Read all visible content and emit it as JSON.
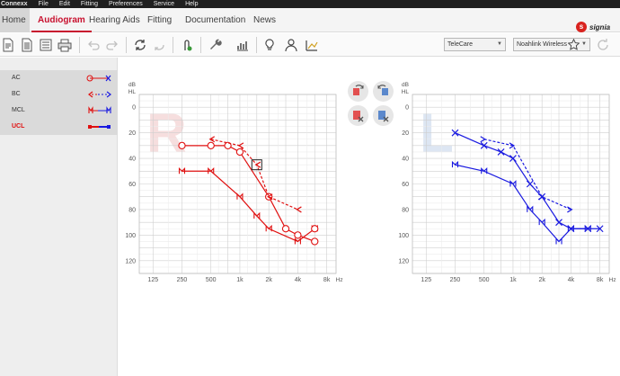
{
  "menubar": {
    "app": "Connexx",
    "items": [
      "File",
      "Edit",
      "Fitting",
      "Preferences",
      "Service",
      "Help"
    ]
  },
  "tabs": {
    "home": "Home",
    "audiogram": "Audiogram",
    "hearing_aids": "Hearing Aids",
    "fitting": "Fitting",
    "documentation": "Documentation",
    "news": "News"
  },
  "brand": {
    "logo_text": "signia",
    "logo_mark": "s"
  },
  "toolbar": {
    "telecare": "TeleCare",
    "wireless": "Noahlink Wireless",
    "icons": [
      "new-document-icon",
      "document-icon",
      "notes-icon",
      "print-icon",
      "undo-icon",
      "redo-icon",
      "rotate-icon",
      "rotate-back-icon",
      "phone-tap-icon",
      "wrench-icon",
      "settings-bars-icon",
      "bulb-icon",
      "person-icon",
      "measurement-icon",
      "star-icon",
      "refresh-icon"
    ]
  },
  "legend": [
    {
      "label": "AC",
      "key": "ac"
    },
    {
      "label": "BC",
      "key": "bc"
    },
    {
      "label": "MCL",
      "key": "mcl"
    },
    {
      "label": "UCL",
      "key": "ucl",
      "active": true
    }
  ],
  "colors": {
    "right_ear": "#e01010",
    "left_ear": "#1a1ae0",
    "accent": "#c8102e",
    "grid": "#d8d8d8"
  },
  "chart_data": [
    {
      "type": "line",
      "ear": "R",
      "ylabel": "dB HL",
      "xlabel": "Hz",
      "x_ticks": [
        "125",
        "250",
        "500",
        "1k",
        "2k",
        "4k",
        "8k"
      ],
      "y_ticks": [
        "0",
        "20",
        "40",
        "60",
        "80",
        "100",
        "120"
      ],
      "ylim": [
        -10,
        130
      ],
      "series": [
        {
          "key": "ac",
          "x": [
            250,
            500,
            750,
            1000,
            2000,
            3000,
            4000,
            6000
          ],
          "y": [
            30,
            30,
            30,
            35,
            70,
            95,
            100,
            105
          ]
        },
        {
          "key": "bc",
          "x": [
            500,
            1000,
            1500,
            2000,
            4000
          ],
          "y": [
            25,
            30,
            45,
            70,
            80
          ]
        },
        {
          "key": "mcl",
          "x": [
            250,
            500,
            1000,
            1500,
            2000,
            4000,
            6000
          ],
          "y": [
            50,
            50,
            70,
            85,
            95,
            105,
            95
          ]
        },
        {
          "key": "ucl",
          "x": [
            6000
          ],
          "y": [
            95
          ]
        },
        {
          "key": "masked",
          "x": [
            1500
          ],
          "y": [
            45
          ]
        }
      ]
    },
    {
      "type": "line",
      "ear": "L",
      "ylabel": "dB HL",
      "xlabel": "Hz",
      "x_ticks": [
        "125",
        "250",
        "500",
        "1k",
        "2k",
        "4k",
        "8k"
      ],
      "y_ticks": [
        "0",
        "20",
        "40",
        "60",
        "80",
        "100",
        "120"
      ],
      "ylim": [
        -10,
        130
      ],
      "series": [
        {
          "key": "ac",
          "x": [
            250,
            500,
            750,
            1000,
            1500,
            2000,
            3000,
            4000,
            6000,
            8000
          ],
          "y": [
            20,
            30,
            35,
            40,
            60,
            70,
            90,
            95,
            95,
            95
          ]
        },
        {
          "key": "bc",
          "x": [
            500,
            1000,
            2000,
            4000
          ],
          "y": [
            25,
            30,
            70,
            80
          ]
        },
        {
          "key": "mcl",
          "x": [
            250,
            500,
            1000,
            1500,
            2000,
            3000,
            4000,
            6000
          ],
          "y": [
            45,
            50,
            60,
            80,
            90,
            105,
            95,
            95
          ]
        }
      ]
    }
  ]
}
